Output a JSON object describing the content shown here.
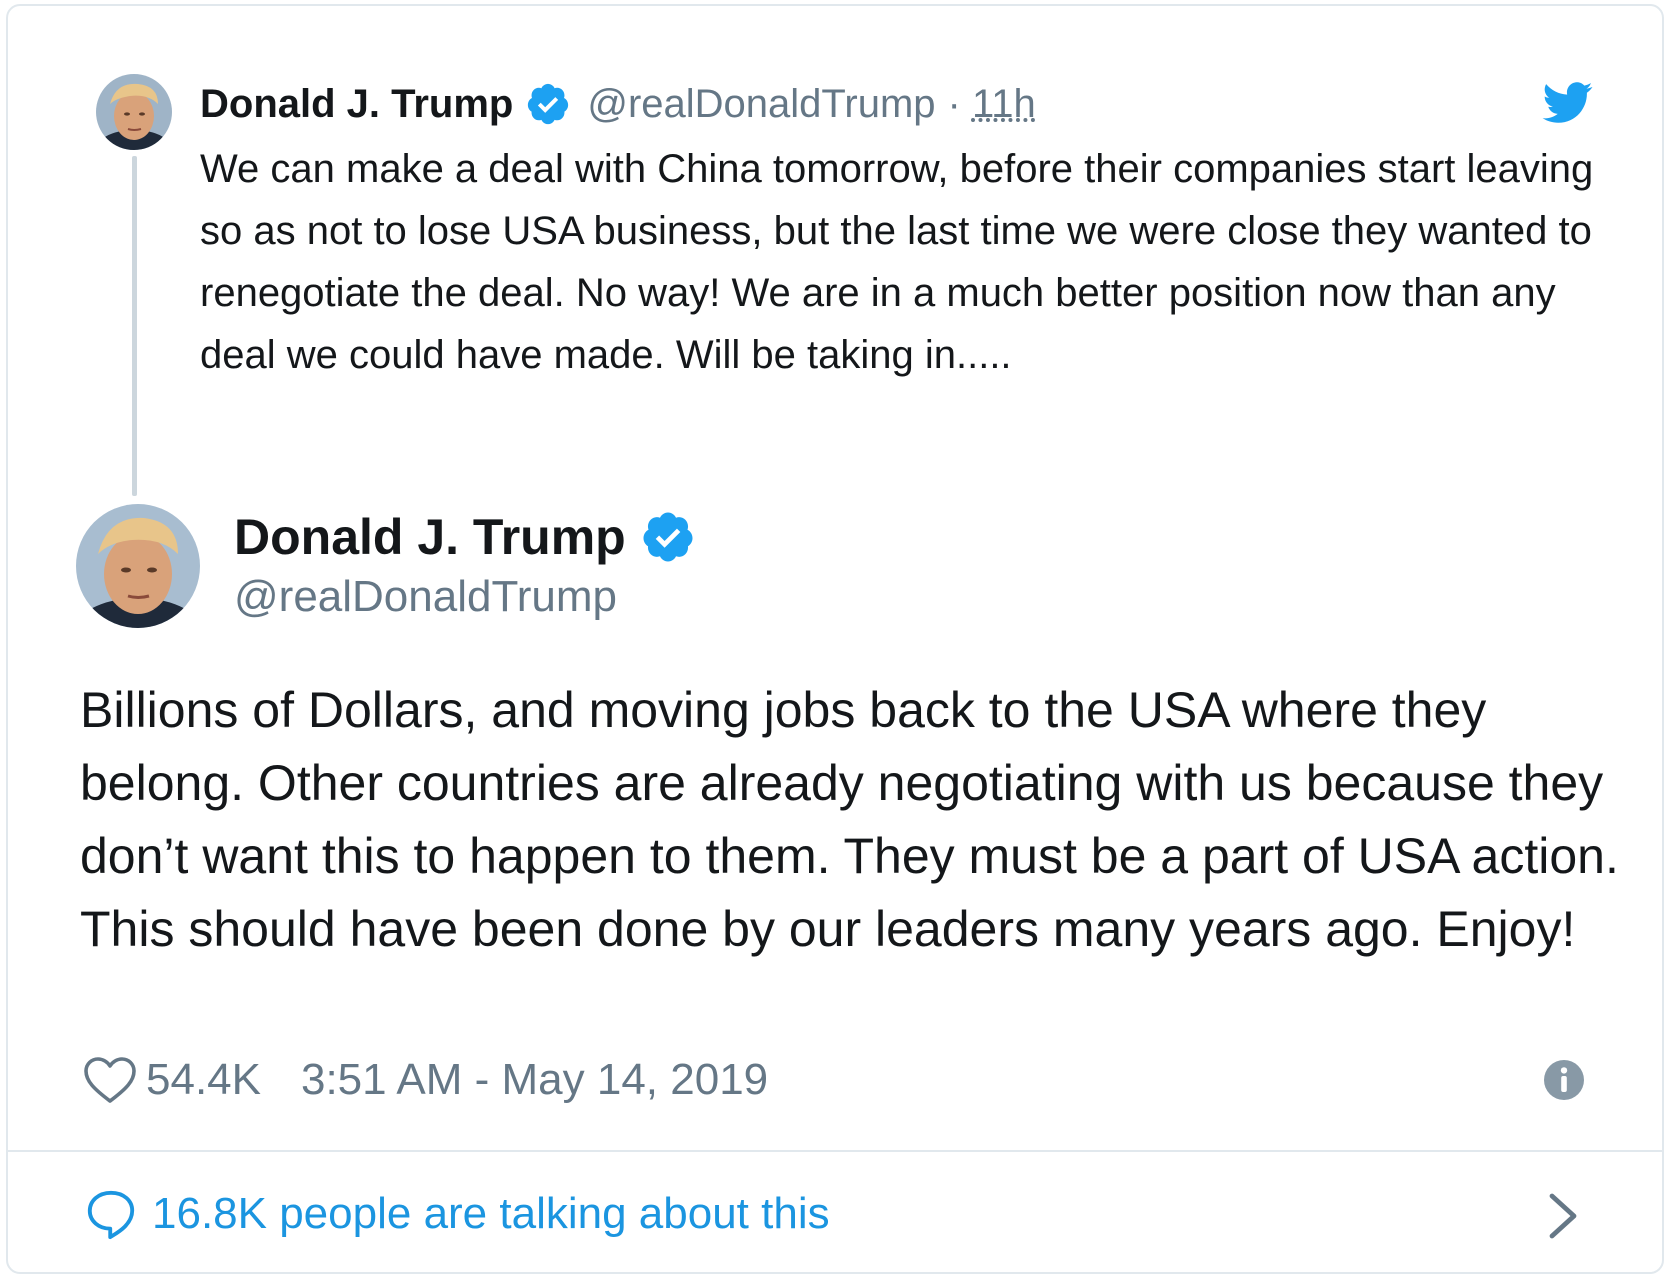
{
  "parent_tweet": {
    "name": "Donald J. Trump",
    "handle": "@realDonaldTrump",
    "separator": "·",
    "time": "11h",
    "text": "We can make a deal with China tomorrow, before their companies start leaving so as not to lose USA business, but the last time we were close they wanted to renegotiate the deal. No way! We are in a much better position now than any deal we could have made. Will be taking in....."
  },
  "main_tweet": {
    "name": "Donald J. Trump",
    "handle": "@realDonaldTrump",
    "text": "Billions of Dollars, and moving jobs back to the USA where they belong. Other countries are already negotiating with us because they don’t want this to happen to them. They must be a part of USA action. This should have been done by our leaders many years ago. Enjoy!",
    "likes": "54.4K",
    "timestamp": "3:51 AM - May 14, 2019"
  },
  "footer": {
    "talking_text": "16.8K people are talking about this"
  },
  "icons": {
    "verified": "verified-badge-icon",
    "bird": "twitter-bird-icon",
    "heart": "heart-icon",
    "info": "info-icon",
    "bubble": "speech-bubble-icon",
    "chevron": "chevron-right-icon"
  },
  "colors": {
    "twitter_blue": "#1da1f2",
    "link_blue": "#1b95e0",
    "secondary_text": "#657786",
    "primary_text": "#14171a",
    "border": "#e1e8ed"
  }
}
